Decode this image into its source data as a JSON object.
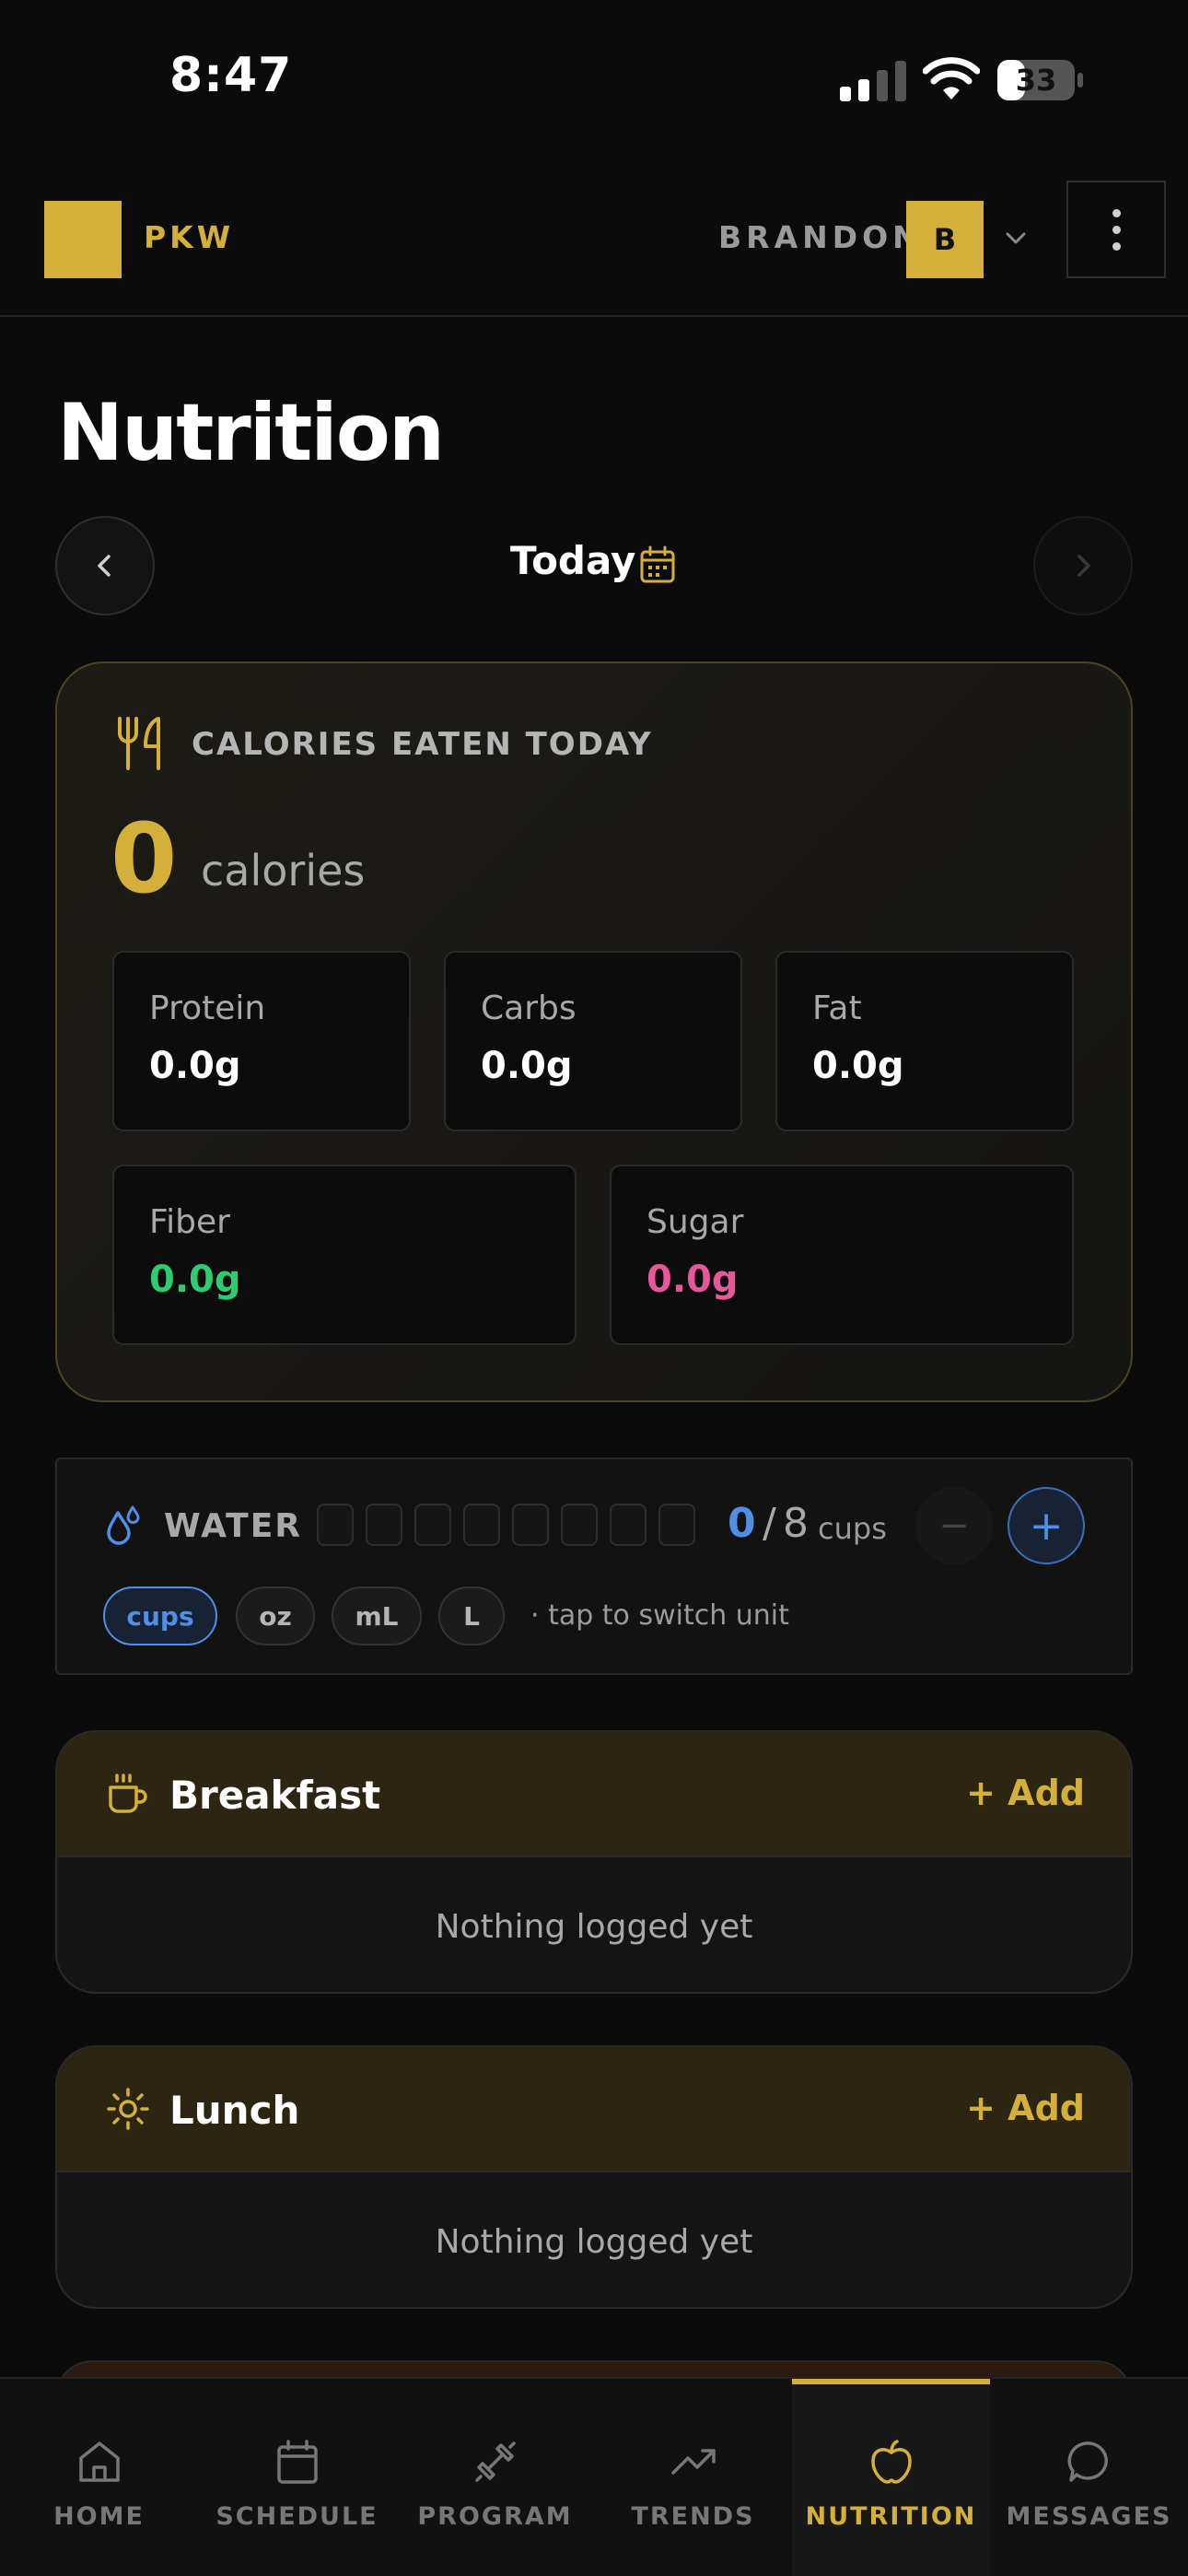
{
  "status_bar": {
    "time": "8:47",
    "battery": "33"
  },
  "header": {
    "logo_text": "PKW",
    "user_name": "BRANDON",
    "avatar_initial": "B"
  },
  "page_title": "Nutrition",
  "date_nav": {
    "label": "Today"
  },
  "calories": {
    "heading": "CALORIES EATEN TODAY",
    "value": "0",
    "unit": "calories",
    "macros": [
      {
        "label": "Protein",
        "value": "0.0g",
        "color": "#ffffff"
      },
      {
        "label": "Carbs",
        "value": "0.0g",
        "color": "#ffffff"
      },
      {
        "label": "Fat",
        "value": "0.0g",
        "color": "#ffffff"
      },
      {
        "label": "Fiber",
        "value": "0.0g",
        "color": "#2ecc71"
      },
      {
        "label": "Sugar",
        "value": "0.0g",
        "color": "#e8579a"
      }
    ]
  },
  "water": {
    "label": "WATER",
    "count": "0",
    "goal": "8",
    "unit": "cups",
    "minus": "−",
    "plus": "+",
    "units": [
      "cups",
      "oz",
      "mL",
      "L"
    ],
    "hint": "· tap to switch unit",
    "accent": "#4f8fe6"
  },
  "meals": [
    {
      "title": "Breakfast",
      "add_label": "+ Add",
      "empty": "Nothing logged yet",
      "icon": "coffee-cup-icon"
    },
    {
      "title": "Lunch",
      "add_label": "+ Add",
      "empty": "Nothing logged yet",
      "icon": "sun-icon"
    }
  ],
  "bottom_nav": [
    {
      "label": "HOME",
      "icon": "home-icon"
    },
    {
      "label": "SCHEDULE",
      "icon": "calendar-icon"
    },
    {
      "label": "PROGRAM",
      "icon": "dumbbell-icon"
    },
    {
      "label": "TRENDS",
      "icon": "trend-icon"
    },
    {
      "label": "NUTRITION",
      "icon": "apple-icon",
      "active": true
    },
    {
      "label": "MESSAGES",
      "icon": "chat-icon"
    }
  ],
  "colors": {
    "accent": "#d4b03a",
    "background": "#0b0b0b"
  }
}
